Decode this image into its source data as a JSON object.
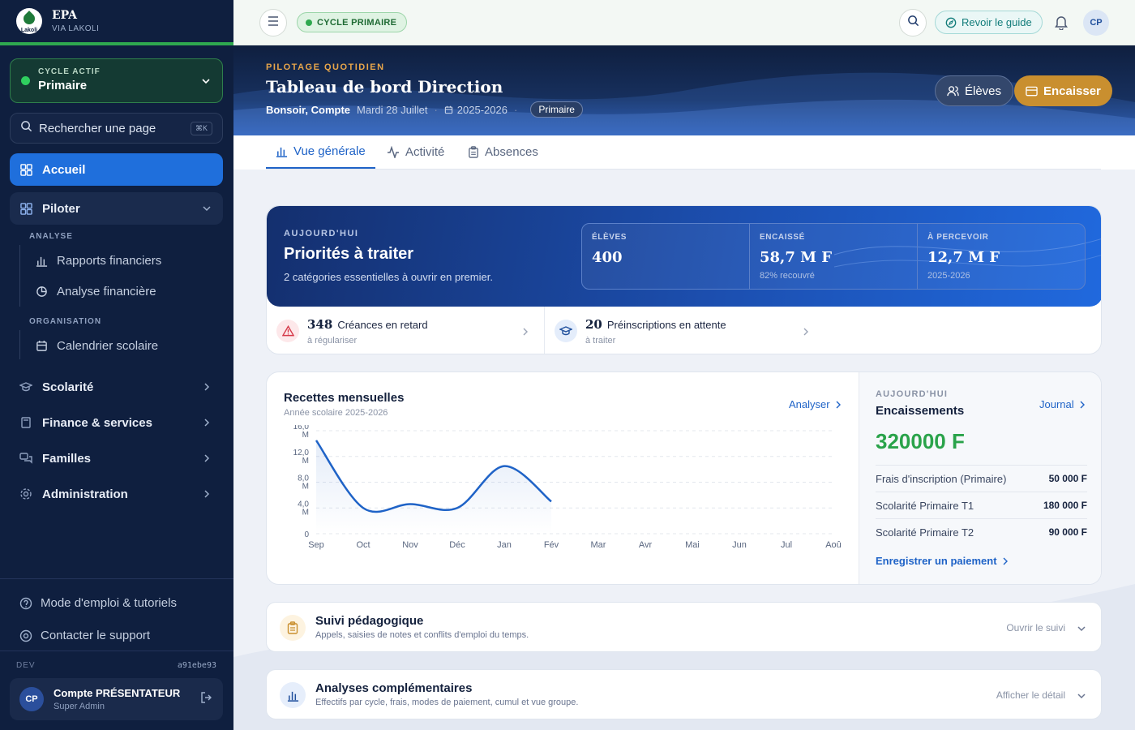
{
  "sidebar": {
    "brand": {
      "title": "EPA",
      "subtitle": "VIA LAKOLI",
      "logo_text": "Lakoli"
    },
    "cycle": {
      "label": "CYCLE ACTIF",
      "value": "Primaire"
    },
    "search": {
      "placeholder": "Rechercher une page",
      "shortcut": "⌘K"
    },
    "items": {
      "accueil": "Accueil",
      "piloter": "Piloter",
      "scolarite": "Scolarité",
      "finance": "Finance & services",
      "familles": "Familles",
      "administration": "Administration"
    },
    "sections": {
      "analyse": "ANALYSE",
      "organisation": "ORGANISATION"
    },
    "sub": {
      "rapports": "Rapports financiers",
      "analyse": "Analyse financière",
      "calendrier": "Calendrier scolaire"
    },
    "footer": {
      "mode": "Mode d'emploi & tutoriels",
      "support": "Contacter le support",
      "env": "DEV",
      "hash": "a91ebe93"
    },
    "user": {
      "initials": "CP",
      "name": "Compte PRÉSENTATEUR",
      "role": "Super Admin"
    }
  },
  "topbar": {
    "cycle_badge": "CYCLE PRIMAIRE",
    "guide": "Revoir le guide",
    "avatar": "CP"
  },
  "hero": {
    "kicker": "PILOTAGE QUOTIDIEN",
    "title": "Tableau de bord Direction",
    "greeting": "Bonsoir, Compte",
    "date": "Mardi 28 Juillet",
    "year": "2025-2026",
    "cycle": "Primaire",
    "btn_eleves": "Élèves",
    "btn_encaisser": "Encaisser"
  },
  "tabs": [
    "Vue générale",
    "Activité",
    "Absences"
  ],
  "priorities": {
    "kicker": "AUJOURD'HUI",
    "title": "Priorités à traiter",
    "subtitle": "2 catégories essentielles à ouvrir en premier.",
    "stats": [
      {
        "label": "ÉLÈVES",
        "value": "400",
        "extra": ""
      },
      {
        "label": "ENCAISSÉ",
        "value": "58,7 M F",
        "extra": "82% recouvré"
      },
      {
        "label": "À PERCEVOIR",
        "value": "12,7 M F",
        "extra": "2025-2026"
      }
    ],
    "items": [
      {
        "count": "348",
        "label": "Créances en retard",
        "sub": "à régulariser"
      },
      {
        "count": "20",
        "label": "Préinscriptions en attente",
        "sub": "à traiter"
      }
    ]
  },
  "recettes": {
    "title": "Recettes mensuelles",
    "subtitle": "Année scolaire 2025-2026",
    "action": "Analyser"
  },
  "chart_data": {
    "type": "line",
    "categories": [
      "Sep",
      "Oct",
      "Nov",
      "Déc",
      "Jan",
      "Fév",
      "Mar",
      "Avr",
      "Mai",
      "Jun",
      "Jul",
      "Aoû"
    ],
    "values": [
      14.5,
      4.0,
      4.6,
      4.0,
      10.5,
      5.0
    ],
    "yticks": [
      "0",
      "4,0 M",
      "8,0 M",
      "12,0 M",
      "16,0 M"
    ],
    "ytick_values": [
      0,
      4,
      8,
      12,
      16
    ],
    "ylim": [
      0,
      16
    ],
    "grid": true,
    "color": "#1f63c7"
  },
  "encaissements": {
    "kicker": "AUJOURD'HUI",
    "title": "Encaissements",
    "link": "Journal",
    "total": "320000 F",
    "rows": [
      {
        "label": "Frais d'inscription (Primaire)",
        "amount": "50 000 F"
      },
      {
        "label": "Scolarité Primaire T1",
        "amount": "180 000 F"
      },
      {
        "label": "Scolarité Primaire T2",
        "amount": "90 000 F"
      }
    ],
    "action": "Enregistrer un paiement"
  },
  "suivi": {
    "title": "Suivi pédagogique",
    "subtitle": "Appels, saisies de notes et conflits d'emploi du temps.",
    "action": "Ouvrir le suivi"
  },
  "analyses": {
    "title": "Analyses complémentaires",
    "subtitle": "Effectifs par cycle, frais, modes de paiement, cumul et vue groupe.",
    "action": "Afficher le détail"
  }
}
